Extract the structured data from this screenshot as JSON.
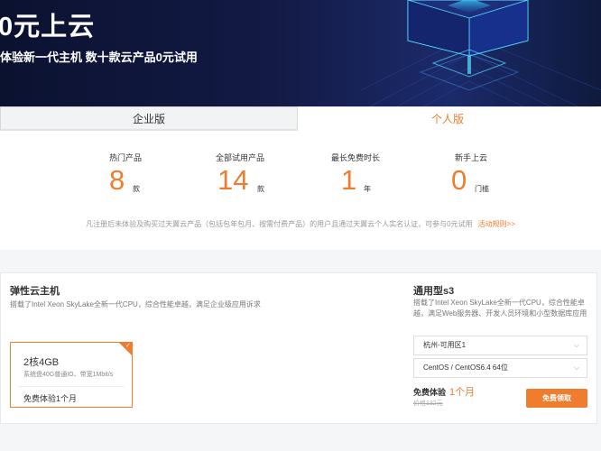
{
  "hero": {
    "title": "0元上云",
    "subtitle": "体验新一代主机 数十款云产品0元试用"
  },
  "tabs": [
    {
      "label": "企业版",
      "active": false
    },
    {
      "label": "个人版",
      "active": true
    }
  ],
  "stats": [
    {
      "label": "热门产品",
      "value": "8",
      "unit": "款"
    },
    {
      "label": "全部试用产品",
      "value": "14",
      "unit": "款"
    },
    {
      "label": "最长免费时长",
      "value": "1",
      "unit": "年"
    },
    {
      "label": "新手上云",
      "value": "0",
      "unit": "门槛"
    }
  ],
  "notice": {
    "text": "凡注册后未体验及购买过天翼云产品（包括包年包月、按需付费产品）的用户且通过天翼云个人实名认证，可参与0元试用",
    "link": "活动规则>>"
  },
  "product": {
    "title": "弹性云主机",
    "description": "搭载了Intel Xeon SkyLake全新一代CPU，综合性能卓越，满足企业级应用诉求",
    "spec": {
      "name": "2核4GB",
      "detail": "系统盘40G普通IO、带宽1Mbit/s",
      "trial": "免费体验1个月",
      "selected": true
    },
    "side": {
      "title": "通用型s3",
      "description": "搭载了Intel Xeon SkyLake全新一代CPU，综合性能卓越，满足Web服务器、开发人员环境和小型数据库应用",
      "region": "杭州-可用区1",
      "os": "CentOS / CentOS6.4 64位",
      "trial_label": "免费体验",
      "trial_period": "1个月",
      "original_price": "价格132元",
      "claim_button": "免费领取"
    }
  },
  "colors": {
    "accent": "#f07c2d",
    "hero_bg": "#131a45"
  }
}
